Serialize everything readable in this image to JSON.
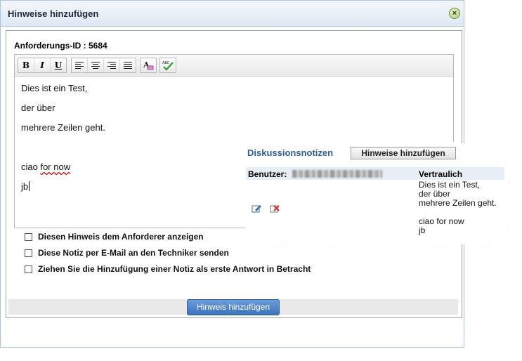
{
  "dialog": {
    "title": "Hinweise hinzufügen",
    "close_symbol": "×",
    "request_id_label": "Anforderungs-ID : 5684"
  },
  "toolbar": {
    "bold": "B",
    "italic": "I",
    "underline": "U",
    "icons": [
      "align-left-icon",
      "align-center-icon",
      "align-right-icon",
      "align-justify-icon",
      "font-color-icon",
      "spellcheck-icon"
    ],
    "spellcheck_label": "ABC"
  },
  "editor": {
    "lines": [
      "Dies ist ein Test,",
      "der über",
      "mehrere Zeilen geht.",
      "",
      "ciao ",
      "jb"
    ],
    "misspelled_words": "for now"
  },
  "options": [
    {
      "label": "Diesen Hinweis dem Anforderer anzeigen",
      "checked": false
    },
    {
      "label": "Diese Notiz per E-Mail an den Techniker senden",
      "checked": false
    },
    {
      "label": "Ziehen Sie die Hinzufügung einer Notiz als erste Antwort in Betracht",
      "checked": false
    }
  ],
  "submit_button": "Hinweis hinzufügen",
  "discussion": {
    "title": "Diskussionsnotizen",
    "add_button": "Hinweise hinzufügen",
    "user_label": "Benutzer:",
    "confidential_label": "Vertraulich",
    "note_lines": [
      "Dies ist ein Test,",
      "der über",
      "mehrere Zeilen geht.",
      "",
      "ciao for now",
      "jb"
    ]
  },
  "colors": {
    "accent": "#2f5f9c",
    "button": "#3d74bd",
    "dialog_border": "#a9c4dc"
  }
}
